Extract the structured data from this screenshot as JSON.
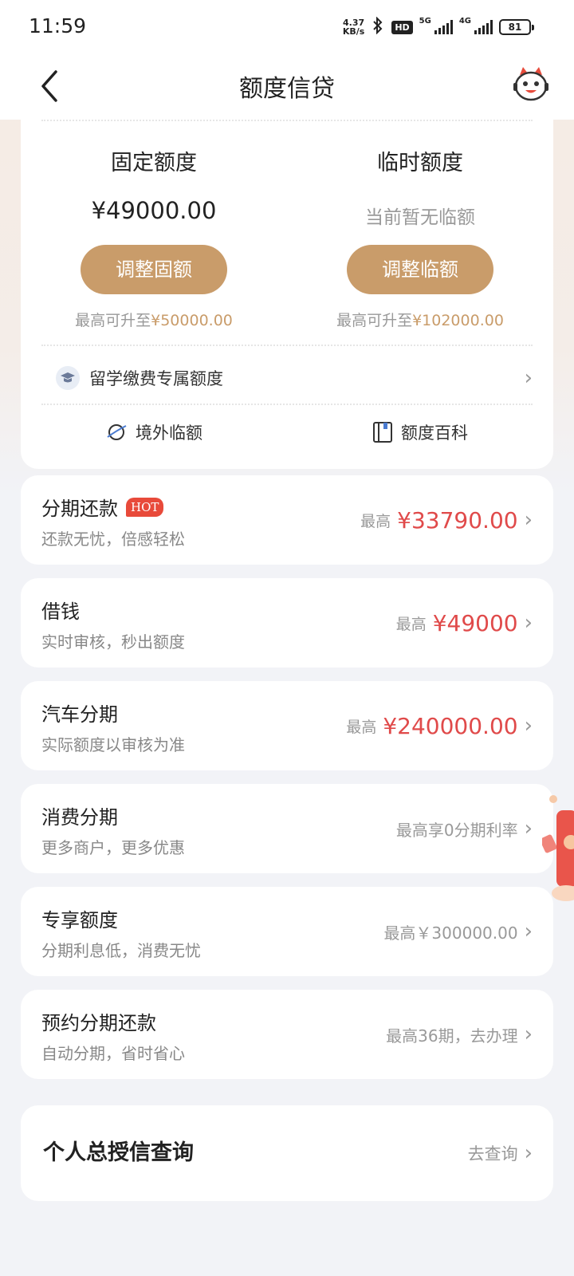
{
  "status_bar": {
    "time": "11:59",
    "speed_value": "4.37",
    "speed_unit": "KB/s",
    "hd": "HD",
    "net1": "5G",
    "net2": "4G",
    "battery": "81"
  },
  "header": {
    "title": "额度信贷"
  },
  "quota": {
    "fixed": {
      "label": "固定额度",
      "amount": "¥49000.00",
      "button": "调整固额",
      "limit_prefix": "最高可升至",
      "limit_value": "¥50000.00"
    },
    "temp": {
      "label": "临时额度",
      "status": "当前暂无临额",
      "button": "调整临额",
      "limit_prefix": "最高可升至",
      "limit_value": "¥102000.00"
    },
    "study_label": "留学缴费专属额度",
    "link_overseas": "境外临额",
    "link_wiki": "额度百科"
  },
  "products": [
    {
      "name": "分期还款",
      "badge": "HOT",
      "desc": "还款无忧，倍感轻松",
      "prefix": "最高",
      "value": "¥33790.00"
    },
    {
      "name": "借钱",
      "desc": "实时审核，秒出额度",
      "prefix": "最高",
      "value": "¥49000"
    },
    {
      "name": "汽车分期",
      "desc": "实际额度以审核为准",
      "prefix": "最高",
      "value": "¥240000.00"
    },
    {
      "name": "消费分期",
      "desc": "更多商户，更多优惠",
      "note": "最高享0分期利率"
    },
    {
      "name": "专享额度",
      "desc": "分期利息低，消费无忧",
      "note": "最高￥300000.00"
    },
    {
      "name": "预约分期还款",
      "desc": "自动分期，省时省心",
      "note": "最高36期，去办理"
    }
  ],
  "credit_query": {
    "label": "个人总授信查询",
    "action": "去查询"
  },
  "colors": {
    "accent_gold": "#c99c6a",
    "price_red": "#e04a4a",
    "hot_red": "#e84a3a"
  }
}
